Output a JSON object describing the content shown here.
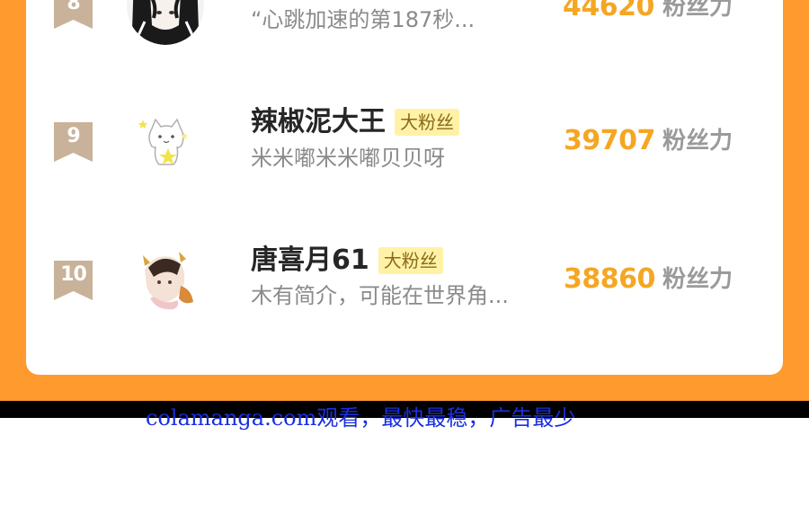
{
  "ranking": [
    {
      "rank": "8",
      "name": "",
      "badge": "",
      "bio": "“心跳加速的第187秒...",
      "score": "44620",
      "score_unit": "粉丝力",
      "rank_color": "#c9b29a",
      "avatar_icon": "anime-girl-avatar"
    },
    {
      "rank": "9",
      "name": "辣椒泥大王",
      "badge": "大粉丝",
      "bio": "米米嘟米米嘟贝贝呀",
      "score": "39707",
      "score_unit": "粉丝力",
      "rank_color": "#c9b29a",
      "avatar_icon": "cat-sticker-avatar"
    },
    {
      "rank": "10",
      "name": "唐喜月61",
      "badge": "大粉丝",
      "bio": "木有简介，可能在世界角...",
      "score": "38860",
      "score_unit": "粉丝力",
      "rank_color": "#c9b29a",
      "avatar_icon": "anime-character-avatar"
    }
  ],
  "watermark": "colamanga.com观看，最快最稳，广告最少",
  "colors": {
    "background_orange": "#ff9a2e",
    "score": "#f5a623",
    "badge_bg": "#fff2a6",
    "watermark": "#1a2fe0"
  }
}
